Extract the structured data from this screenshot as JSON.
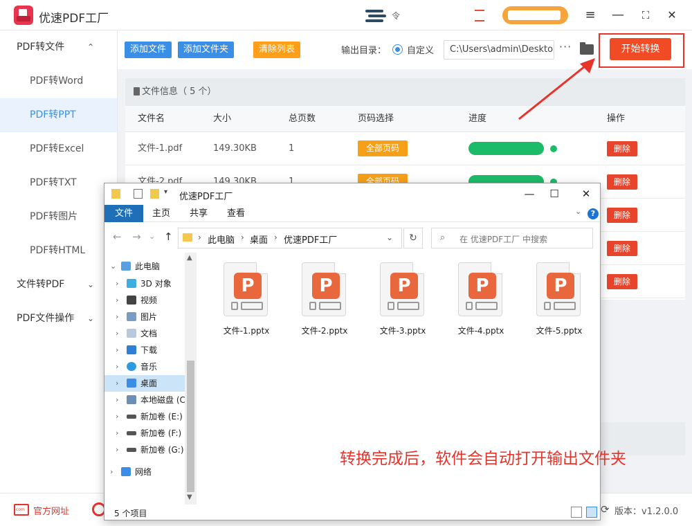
{
  "app": {
    "title": "优速PDF工厂",
    "center_glyph": "令"
  },
  "window_controls": {
    "menu": "≡",
    "minimize": "—",
    "maximize": "⛶",
    "close": "✕"
  },
  "sidebar": {
    "groups": [
      {
        "label": "PDF转文件",
        "chevron": "⌃"
      },
      {
        "label": "文件转PDF",
        "chevron": "⌄"
      },
      {
        "label": "PDF文件操作",
        "chevron": "⌄"
      }
    ],
    "items": [
      "PDF转Word",
      "PDF转PPT",
      "PDF转Excel",
      "PDF转TXT",
      "PDF转图片",
      "PDF转HTML"
    ],
    "active_item": "PDF转PPT"
  },
  "toolbar": {
    "add_file": "添加文件",
    "add_folder": "添加文件夹",
    "clear_list": "清除列表",
    "output_label": "输出目录：",
    "custom_label": "自定义",
    "output_path": "C:\\Users\\admin\\Desktop",
    "more": "···",
    "start": "开始转换"
  },
  "file_info": {
    "header": "文件信息（ 5 个）",
    "columns": [
      "文件名",
      "大小",
      "总页数",
      "页码选择",
      "进度",
      "操作"
    ],
    "rows": [
      {
        "name": "文件-1.pdf",
        "size": "149.30KB",
        "pages": "1",
        "page_select": "全部页码",
        "progress": 1.0,
        "action": "删除"
      },
      {
        "name": "文件-2.pdf",
        "size": "149.30KB",
        "pages": "1",
        "page_select": "全部页码",
        "progress": 1.0,
        "action": "删除"
      }
    ],
    "extra_delete_buttons": [
      "删除",
      "删除",
      "删除"
    ]
  },
  "footer": {
    "website": "官方网址",
    "version": "版本：v1.2.0.0"
  },
  "explorer": {
    "title": "优速PDF工厂",
    "ribbon_tabs": [
      "文件",
      "主页",
      "共享",
      "查看"
    ],
    "help": "?",
    "breadcrumb": [
      "此电脑",
      "桌面",
      "优速PDF工厂"
    ],
    "search_placeholder": "在 优速PDF工厂 中搜索",
    "nav_tree": [
      {
        "label": "此电脑",
        "icon": "pc-icon"
      },
      {
        "label": "3D 对象",
        "icon": "cube-icon"
      },
      {
        "label": "视频",
        "icon": "video-icon"
      },
      {
        "label": "图片",
        "icon": "picture-icon"
      },
      {
        "label": "文档",
        "icon": "document-icon"
      },
      {
        "label": "下载",
        "icon": "download-icon"
      },
      {
        "label": "音乐",
        "icon": "music-icon"
      },
      {
        "label": "桌面",
        "icon": "desktop-icon"
      },
      {
        "label": "本地磁盘 (C:)",
        "icon": "drive-c-icon"
      },
      {
        "label": "新加卷 (E:)",
        "icon": "drive-icon"
      },
      {
        "label": "新加卷 (F:)",
        "icon": "drive-icon"
      },
      {
        "label": "新加卷 (G:)",
        "icon": "drive-icon"
      },
      {
        "label": "网络",
        "icon": "network-icon"
      }
    ],
    "selected_tree_item": "桌面",
    "files": [
      "文件-1.pptx",
      "文件-2.pptx",
      "文件-3.pptx",
      "文件-4.pptx",
      "文件-5.pptx"
    ],
    "file_icon_letter": "P",
    "note": "转换完成后，软件会自动打开输出文件夹",
    "status": "5 个项目"
  },
  "colors": {
    "accent_blue": "#3a8ee6",
    "accent_orange": "#ff9f19",
    "start_red": "#f04b25",
    "progress_green": "#1cbb6a",
    "annotation_red": "#e8332a",
    "ppt_orange": "#e8673c"
  }
}
